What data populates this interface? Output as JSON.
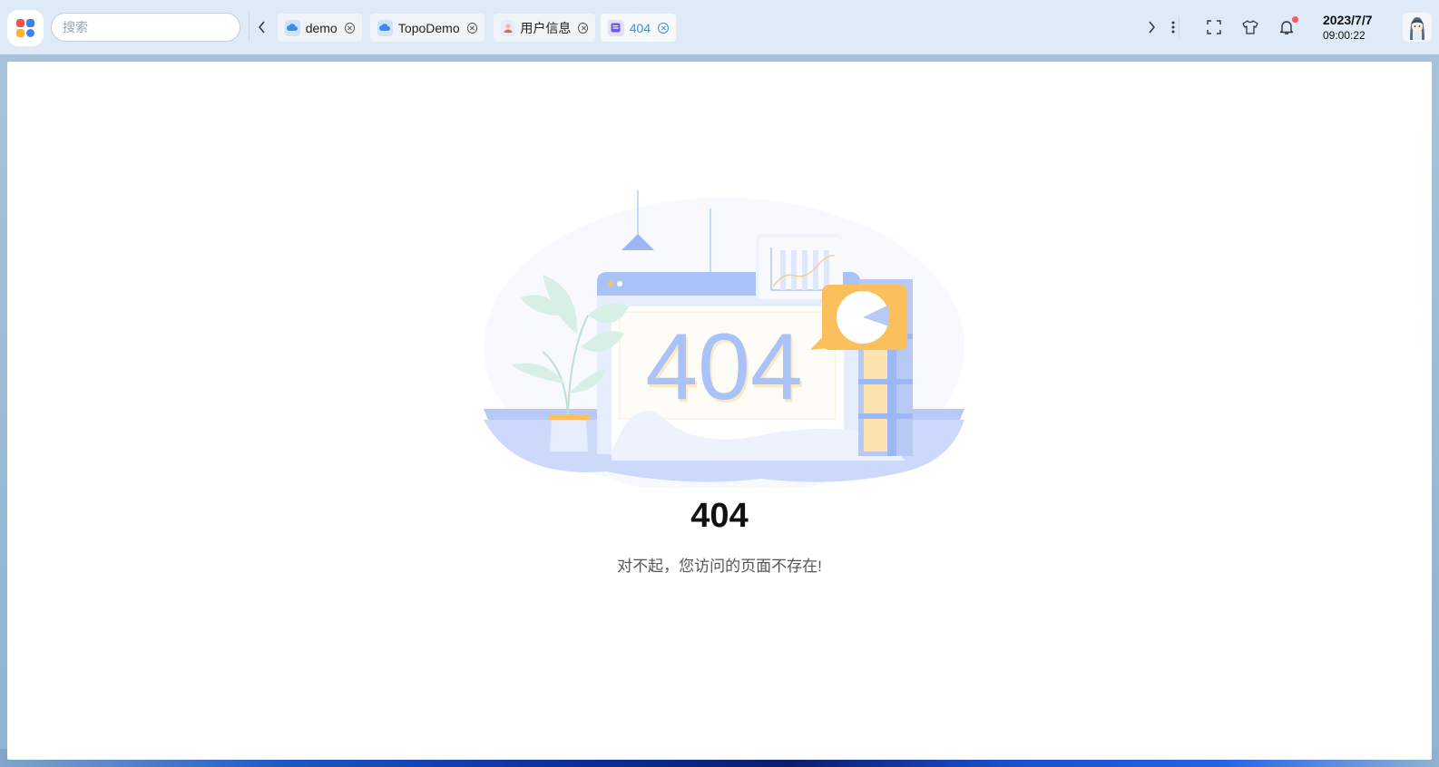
{
  "header": {
    "search": {
      "placeholder": "搜索",
      "value": ""
    },
    "tabs": [
      {
        "label": "demo",
        "icon": "cloud-icon",
        "active": false
      },
      {
        "label": "TopoDemo",
        "icon": "cloud-icon",
        "active": false
      },
      {
        "label": "用户信息",
        "icon": "user-info-icon",
        "active": false
      },
      {
        "label": "404",
        "icon": "document-icon",
        "active": true
      }
    ],
    "clock": {
      "date": "2023/7/7",
      "time": "09:00:22"
    }
  },
  "main": {
    "illustration_text": "404",
    "error_code": "404",
    "error_message": "对不起，您访问的页面不存在!"
  },
  "colors": {
    "active_tab": "#3b8cf0",
    "notification_dot": "#f45b5b",
    "illustration_blue": "#a9c2f7",
    "illustration_orange": "#fbbf5c"
  }
}
